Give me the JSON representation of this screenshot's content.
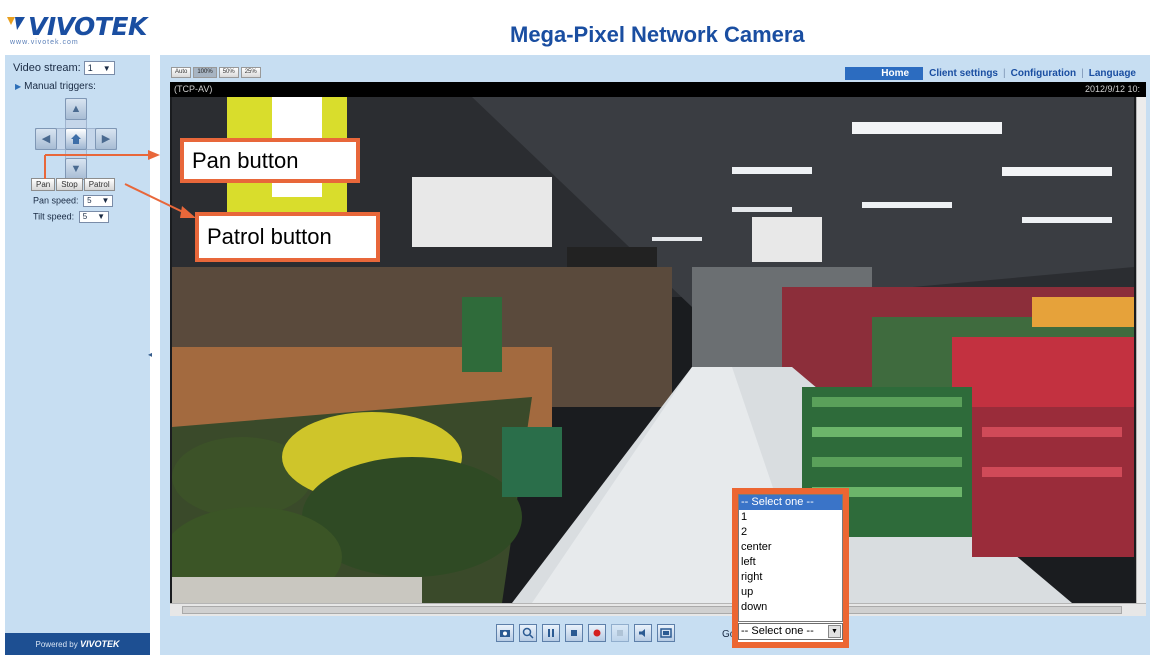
{
  "header": {
    "brand": "VIVOTEK",
    "brand_url": "www.vivotek.com",
    "title": "Mega-Pixel Network Camera"
  },
  "sidebar": {
    "video_stream_label": "Video stream:",
    "video_stream_value": "1",
    "manual_triggers_label": "Manual triggers:",
    "pan_label": "Pan",
    "stop_label": "Stop",
    "patrol_label": "Patrol",
    "pan_speed_label": "Pan speed:",
    "pan_speed_value": "5",
    "tilt_speed_label": "Tilt speed:",
    "tilt_speed_value": "5",
    "powered_by": "Powered by",
    "powered_brand": "VIVOTEK"
  },
  "zoom": {
    "buttons": [
      "Auto",
      "100%",
      "50%",
      "25%"
    ],
    "active": "100%"
  },
  "nav": {
    "home": "Home",
    "client_settings": "Client settings",
    "configuration": "Configuration",
    "language": "Language"
  },
  "video": {
    "protocol": "(TCP-AV)",
    "timestamp": "2012/9/12 10:"
  },
  "toolbar": {
    "icons": [
      "snapshot-icon",
      "digital-zoom-icon",
      "pause-icon",
      "stop-icon",
      "record-icon",
      "volume-icon",
      "mute-icon",
      "fullscreen-icon"
    ],
    "goto_label": "Go to"
  },
  "callouts": {
    "pan": "Pan button",
    "patrol": "Patrol button"
  },
  "preset_dropdown": {
    "options": [
      "-- Select one --",
      "1",
      "2",
      "center",
      "left",
      "right",
      "up",
      "down"
    ],
    "selected": "-- Select one --"
  },
  "colors": {
    "brand_blue": "#1a4ea1",
    "panel_bg": "#c7def2",
    "annotation_orange": "#e8673a",
    "nav_active": "#2c6cc0"
  }
}
